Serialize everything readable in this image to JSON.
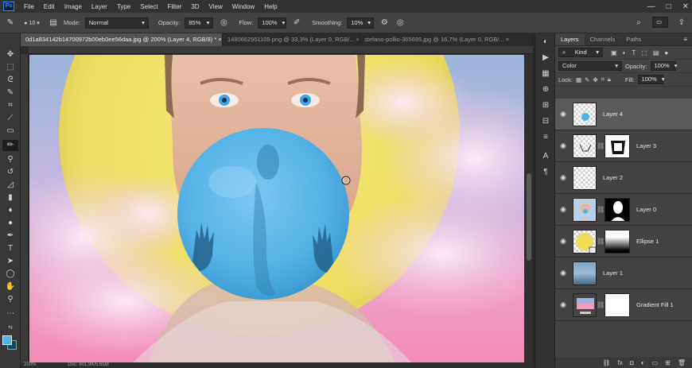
{
  "app": {
    "logo": "Ps"
  },
  "menu": [
    "File",
    "Edit",
    "Image",
    "Layer",
    "Type",
    "Select",
    "Filter",
    "3D",
    "View",
    "Window",
    "Help"
  ],
  "window_controls": {
    "minimize": "—",
    "restore": "□",
    "close": "✕"
  },
  "options": {
    "brush_size": "10",
    "mode_label": "Mode:",
    "mode_value": "Normal",
    "opacity_label": "Opacity:",
    "opacity_value": "85%",
    "flow_label": "Flow:",
    "flow_value": "100%",
    "smoothing_label": "Smoothing:",
    "smoothing_value": "10%"
  },
  "tabs": [
    {
      "label": "0d1a834142b14700972b00eb0ee56daa.jpg @ 200% (Layer 4, RGB/8) *",
      "close": "×"
    },
    {
      "label": "1480662951109.png @ 33,3% (Layer 0, RGB/...",
      "close": "×"
    },
    {
      "label": "stefano-pollio-365695.jpg @ 16,7% (Layer 0, RGB/...",
      "close": "×"
    }
  ],
  "status": {
    "zoom": "200%",
    "doc": "Doc: 801,9K/5,65M"
  },
  "panel": {
    "tabs": [
      "Layers",
      "Channels",
      "Paths"
    ],
    "kind_label": "Kind",
    "blend_mode": "Color",
    "opacity_label": "Opacity:",
    "opacity_value": "100%",
    "lock_label": "Lock:",
    "fill_label": "Fill:",
    "fill_value": "100%",
    "layers": [
      {
        "name": "Layer 4"
      },
      {
        "name": "Layer 3"
      },
      {
        "name": "Layer 2"
      },
      {
        "name": "Layer 0"
      },
      {
        "name": "Ellipse 1"
      },
      {
        "name": "Layer 1"
      },
      {
        "name": "Gradient Fill 1"
      }
    ],
    "footer_icons": [
      "link-icon",
      "fx-icon",
      "mask-icon",
      "adjustment-icon",
      "folder-icon",
      "new-layer-icon",
      "trash-icon"
    ]
  },
  "colors": {
    "foreground": "#4fb3e8",
    "background": "#0f4d6e",
    "accent": "#2f8fff",
    "sun": "#f0e26a",
    "bubble": "#59b8ec"
  }
}
